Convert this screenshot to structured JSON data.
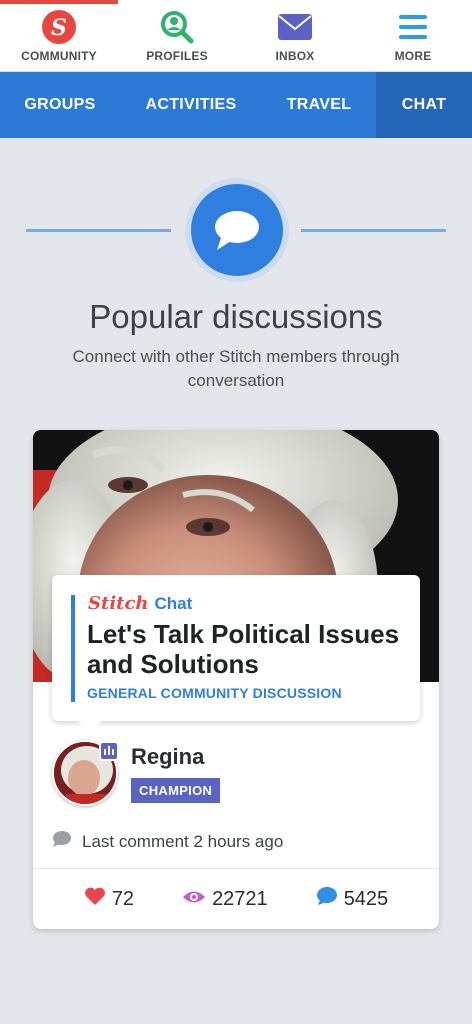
{
  "top_tabs": [
    {
      "label": "COMMUNITY",
      "icon": "stitch-logo-icon",
      "active": true
    },
    {
      "label": "PROFILES",
      "icon": "search-profile-icon",
      "active": false
    },
    {
      "label": "INBOX",
      "icon": "envelope-icon",
      "active": false
    },
    {
      "label": "MORE",
      "icon": "hamburger-menu-icon",
      "active": false
    }
  ],
  "sub_tabs": [
    {
      "label": "GROUPS",
      "active": false
    },
    {
      "label": "ACTIVITIES",
      "active": false
    },
    {
      "label": "TRAVEL",
      "active": false
    },
    {
      "label": "CHAT",
      "active": true
    }
  ],
  "hero": {
    "icon": "chat-bubble-icon",
    "title": "Popular discussions",
    "subtitle": "Connect with other Stitch members through conversation"
  },
  "card": {
    "brand": "Stitch",
    "brand_section": "Chat",
    "title": "Let's Talk Political Issues and Solutions",
    "category": "GENERAL COMMUNITY DISCUSSION",
    "author": {
      "name": "Regina",
      "rank": "CHAMPION"
    },
    "last_comment": "Last comment 2 hours ago",
    "stats": {
      "likes": "72",
      "views": "22721",
      "comments": "5425"
    }
  },
  "colors": {
    "brand_red": "#e8473f",
    "brand_blue": "#2f7fe0",
    "nav_blue": "#2d79d6",
    "rank_purple": "#5a63c4"
  }
}
